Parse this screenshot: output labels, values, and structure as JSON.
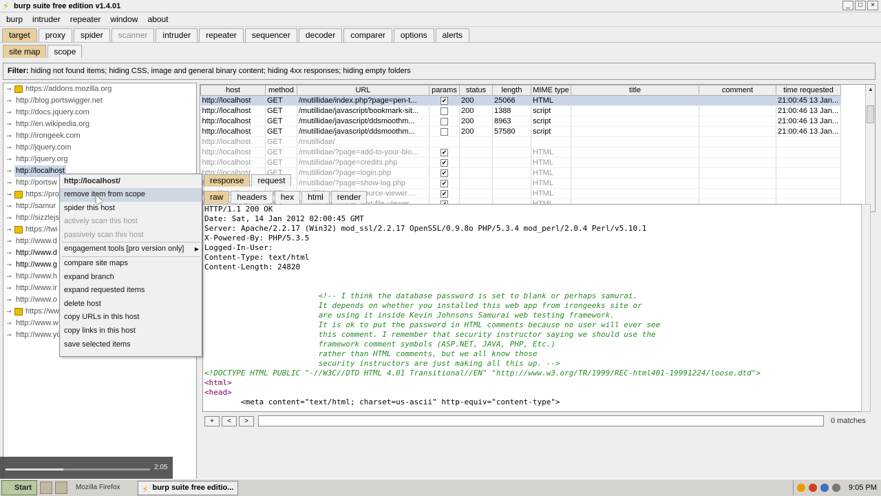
{
  "window": {
    "title": "burp suite free edition v1.4.01",
    "controls": [
      "_",
      "□",
      "×"
    ]
  },
  "menu": [
    "burp",
    "intruder",
    "repeater",
    "window",
    "about"
  ],
  "main_tabs": [
    "target",
    "proxy",
    "spider",
    "scanner",
    "intruder",
    "repeater",
    "sequencer",
    "decoder",
    "comparer",
    "options",
    "alerts"
  ],
  "sub_tabs": [
    "site map",
    "scope"
  ],
  "filter": {
    "label": "Filter:",
    "text": "hiding not found items;  hiding CSS, image and general binary content;  hiding 4xx responses;  hiding empty folders"
  },
  "tree": [
    {
      "label": "https://addons.mozilla.org",
      "lock": true
    },
    {
      "label": "http://blog.portswigger.net",
      "lock": false
    },
    {
      "label": "http://docs.jquery.com",
      "lock": false
    },
    {
      "label": "http://en.wikipedia.org",
      "lock": false
    },
    {
      "label": "http://irongeek.com",
      "lock": false
    },
    {
      "label": "http://jquery.com",
      "lock": false
    },
    {
      "label": "http://jquery.org",
      "lock": false
    },
    {
      "label": "http://localhost",
      "lock": false
    },
    {
      "label": "http://portsw",
      "lock": false
    },
    {
      "label": "https://pro",
      "lock": true
    },
    {
      "label": "http://samur",
      "lock": false
    },
    {
      "label": "http://sizzlejs",
      "lock": false
    },
    {
      "label": "https://twi",
      "lock": true
    },
    {
      "label": "http://www.d",
      "lock": false
    },
    {
      "label": "http://www.d",
      "lock": false
    },
    {
      "label": "http://www.g",
      "lock": false
    },
    {
      "label": "http://www.h",
      "lock": false
    },
    {
      "label": "http://www.ir",
      "lock": false
    },
    {
      "label": "http://www.o",
      "lock": false
    },
    {
      "label": "https://ww",
      "lock": true
    },
    {
      "label": "http://www.w",
      "lock": false
    },
    {
      "label": "http://www.yo",
      "lock": false
    }
  ],
  "table": {
    "headers": [
      "host",
      "method",
      "URL",
      "params",
      "status",
      "length",
      "MIME type",
      "title",
      "comment",
      "time requested"
    ],
    "rows": [
      [
        "http://localhost",
        "GET",
        "/mutillidae/index.php?page=pen-t...",
        "✔",
        "200",
        "25066",
        "HTML",
        "",
        "",
        "21:00:45 13 Jan..."
      ],
      [
        "http://localhost",
        "GET",
        "/mutillidae/javascript/bookmark-sit...",
        "",
        "200",
        "1388",
        "script",
        "",
        "",
        "21:00:46 13 Jan..."
      ],
      [
        "http://localhost",
        "GET",
        "/mutillidae/javascript/ddsmoothm...",
        "",
        "200",
        "8963",
        "script",
        "",
        "",
        "21:00:46 13 Jan..."
      ],
      [
        "http://localhost",
        "GET",
        "/mutillidae/javascript/ddsmoothm...",
        "",
        "200",
        "57580",
        "script",
        "",
        "",
        "21:00:46 13 Jan..."
      ],
      [
        "http://localhost",
        "GET",
        "/mutillidae/",
        "",
        "",
        "",
        "",
        "",
        "",
        ""
      ],
      [
        "http://localhost",
        "GET",
        "/mutillidae/?page=add-to-your-blo...",
        "✔",
        "",
        "",
        "HTML",
        "",
        "",
        ""
      ],
      [
        "http://localhost",
        "GET",
        "/mutillidae/?page=credits.php",
        "✔",
        "",
        "",
        "HTML",
        "",
        "",
        ""
      ],
      [
        "http://localhost",
        "GET",
        "/mutillidae/?page=login.php",
        "✔",
        "",
        "",
        "HTML",
        "",
        "",
        ""
      ],
      [
        "http://localhost",
        "GET",
        "/mutillidae/?page=show-log.php",
        "✔",
        "",
        "",
        "HTML",
        "",
        "",
        ""
      ],
      [
        "http://localhost",
        "GET",
        "/mutillidae/?page=source-viewer....",
        "✔",
        "",
        "",
        "HTML",
        "",
        "",
        ""
      ],
      [
        "http://localhost",
        "GET",
        "/mutillidae/?page=text-file-viewer....",
        "✔",
        "",
        "",
        "HTML",
        "",
        "",
        ""
      ]
    ]
  },
  "response_tabs": [
    "response",
    "request"
  ],
  "view_tabs": [
    "raw",
    "headers",
    "hex",
    "html",
    "render"
  ],
  "response_lines": [
    "HTTP/1.1 200 OK",
    "Date: Sat, 14 Jan 2012 02:00:45 GMT",
    "Server: Apache/2.2.17 (Win32) mod_ssl/2.2.17 OpenSSL/0.9.8o PHP/5.3.4 mod_perl/2.0.4 Perl/v5.10.1",
    "X-Powered-By: PHP/5.3.5",
    "Logged-In-User:",
    "Content-Type: text/html",
    "Content-Length: 24820",
    "",
    "",
    "                         <!-- I think the database password is set to blank or perhaps samurai.",
    "                         It depends on whether you installed this web app from irongeeks site or",
    "                         are using it inside Kevin Johnsons Samurai web testing framework.",
    "                         It is ok to put the password in HTML comments because no user will ever see",
    "                         this comment. I remember that security instructor saying we should use the",
    "                         framework comment symbols (ASP.NET, JAVA, PHP, Etc.)",
    "                         rather than HTML comments, but we all know those",
    "                         security instructors are just making all this up. -->",
    "<!DOCTYPE HTML PUBLIC \"-//W3C//DTD HTML 4.01 Transitional//EN\" \"http://www.w3.org/TR/1999/REC-html401-19991224/loose.dtd\">",
    "<html>",
    "<head>",
    "        <meta content=\"text/html; charset=us-ascii\" http-equiv=\"content-type\">"
  ],
  "line_styles": [
    "bl",
    "bl",
    "bl",
    "bl",
    "bl",
    "bl",
    "bl",
    "bl",
    "bl",
    "cm",
    "cm",
    "cm",
    "cm",
    "cm",
    "cm",
    "cm",
    "cm",
    "cm",
    "tg",
    "tg",
    "bl"
  ],
  "search": {
    "buttons": [
      "+",
      "<",
      ">"
    ],
    "matches": "0 matches"
  },
  "context_menu": {
    "header": "http://localhost/",
    "items": [
      {
        "label": "remove item from scope",
        "state": "hl"
      },
      {
        "label": "spider this host",
        "state": ""
      },
      {
        "label": "actively scan this host",
        "state": "dis"
      },
      {
        "label": "passively scan this host",
        "state": "dis"
      },
      {
        "label": "engagement tools [pro version only]",
        "state": "sub"
      },
      {
        "label": "compare site maps",
        "state": ""
      },
      {
        "label": "expand branch",
        "state": ""
      },
      {
        "label": "expand requested items",
        "state": ""
      },
      {
        "label": "delete host",
        "state": ""
      },
      {
        "label": "copy URLs in this host",
        "state": ""
      },
      {
        "label": "copy links in this host",
        "state": ""
      },
      {
        "label": "save selected items",
        "state": ""
      }
    ]
  },
  "video": {
    "time": "2:05",
    "progress": 0.4
  },
  "taskbar": {
    "start": "Start",
    "firefox": "Mozilla Firefox",
    "active_task": "burp suite free editio...",
    "clock": "9:05 PM"
  },
  "colors": {
    "active_tab": "#e9cfa0",
    "selection": "#c8d6e8",
    "comment": "#2a8a2a",
    "tag": "#800060"
  }
}
